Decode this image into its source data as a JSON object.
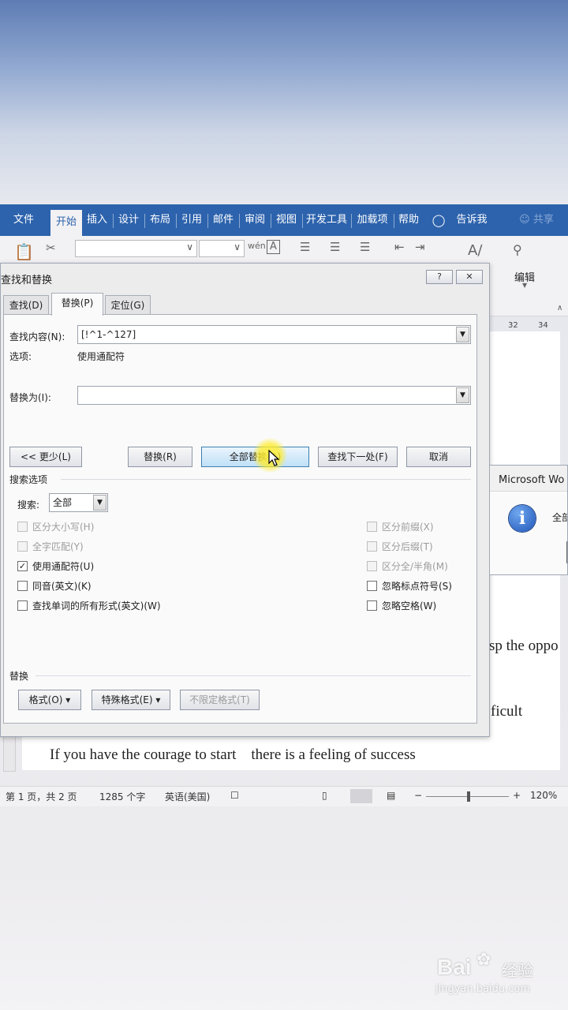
{
  "ribbon": {
    "tabs": [
      {
        "label": "文件"
      },
      {
        "label": "开始"
      },
      {
        "label": "插入"
      },
      {
        "label": "设计"
      },
      {
        "label": "布局"
      },
      {
        "label": "引用"
      },
      {
        "label": "邮件"
      },
      {
        "label": "审阅"
      },
      {
        "label": "视图"
      },
      {
        "label": "开发工具"
      },
      {
        "label": "加载项"
      },
      {
        "label": "帮助"
      }
    ],
    "active_tab": "开始",
    "tell_me": "告诉我",
    "share": "共享",
    "edit_group": "编辑",
    "accent_color": "#2d63ad"
  },
  "ruler": {
    "marks": [
      "32",
      "34"
    ]
  },
  "document": {
    "lines": [
      "sp the oppo",
      "ficult",
      "If you have the courage to start    there is a feeling of success"
    ]
  },
  "dialog": {
    "title": "查找和替换",
    "help_btn": "?",
    "close_btn": "✕",
    "tabs": [
      {
        "label": "查找(D)"
      },
      {
        "label": "替换(P)"
      },
      {
        "label": "定位(G)"
      }
    ],
    "find_label": "查找内容(N):",
    "find_value": "[!^1-^127]",
    "options_label": "选项:",
    "options_value": "使用通配符",
    "replace_label": "替换为(I):",
    "replace_value": "",
    "buttons": {
      "less": "<< 更少(L)",
      "replace": "替换(R)",
      "replace_all": "全部替换(A)",
      "find_next": "查找下一处(F)",
      "cancel": "取消"
    },
    "search_options_title": "搜索选项",
    "search_label": "搜索:",
    "search_value": "全部",
    "left_options": [
      {
        "label": "区分大小写(H)",
        "checked": false,
        "disabled": true
      },
      {
        "label": "全字匹配(Y)",
        "checked": false,
        "disabled": true
      },
      {
        "label": "使用通配符(U)",
        "checked": true,
        "disabled": false
      },
      {
        "label": "同音(英文)(K)",
        "checked": false,
        "disabled": false
      },
      {
        "label": "查找单词的所有形式(英文)(W)",
        "checked": false,
        "disabled": false
      }
    ],
    "right_options": [
      {
        "label": "区分前缀(X)",
        "checked": false,
        "disabled": true
      },
      {
        "label": "区分后缀(T)",
        "checked": false,
        "disabled": true
      },
      {
        "label": "区分全/半角(M)",
        "checked": false,
        "disabled": true
      },
      {
        "label": "忽略标点符号(S)",
        "checked": false,
        "disabled": false
      },
      {
        "label": "忽略空格(W)",
        "checked": false,
        "disabled": false
      }
    ],
    "replace_section_title": "替换",
    "format_btn": "格式(O) ▾",
    "special_btn": "特殊格式(E) ▾",
    "no_format_btn": "不限定格式(T)"
  },
  "msgbox": {
    "title": "Microsoft Wo",
    "text": "全部",
    "icon": "info-icon"
  },
  "statusbar": {
    "page": "第 1 页，共 2 页",
    "words": "1285 个字",
    "language": "英语(美国)",
    "zoom": "120%",
    "minus": "−",
    "plus": "+"
  },
  "watermark": {
    "brand": "Bai",
    "brand_cn": "经验",
    "url": "jingyan.baidu.com"
  }
}
